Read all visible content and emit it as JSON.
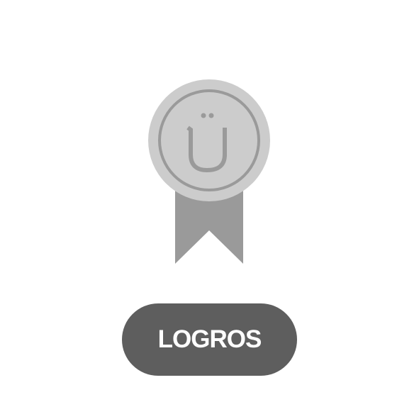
{
  "badge": {
    "icon": "medal-icon",
    "emblem_letter": "Ü"
  },
  "button": {
    "label": "LOGROS"
  },
  "colors": {
    "button": "#5e5e5e",
    "medal": "#cccccc",
    "ribbon": "#9a9a9a"
  }
}
